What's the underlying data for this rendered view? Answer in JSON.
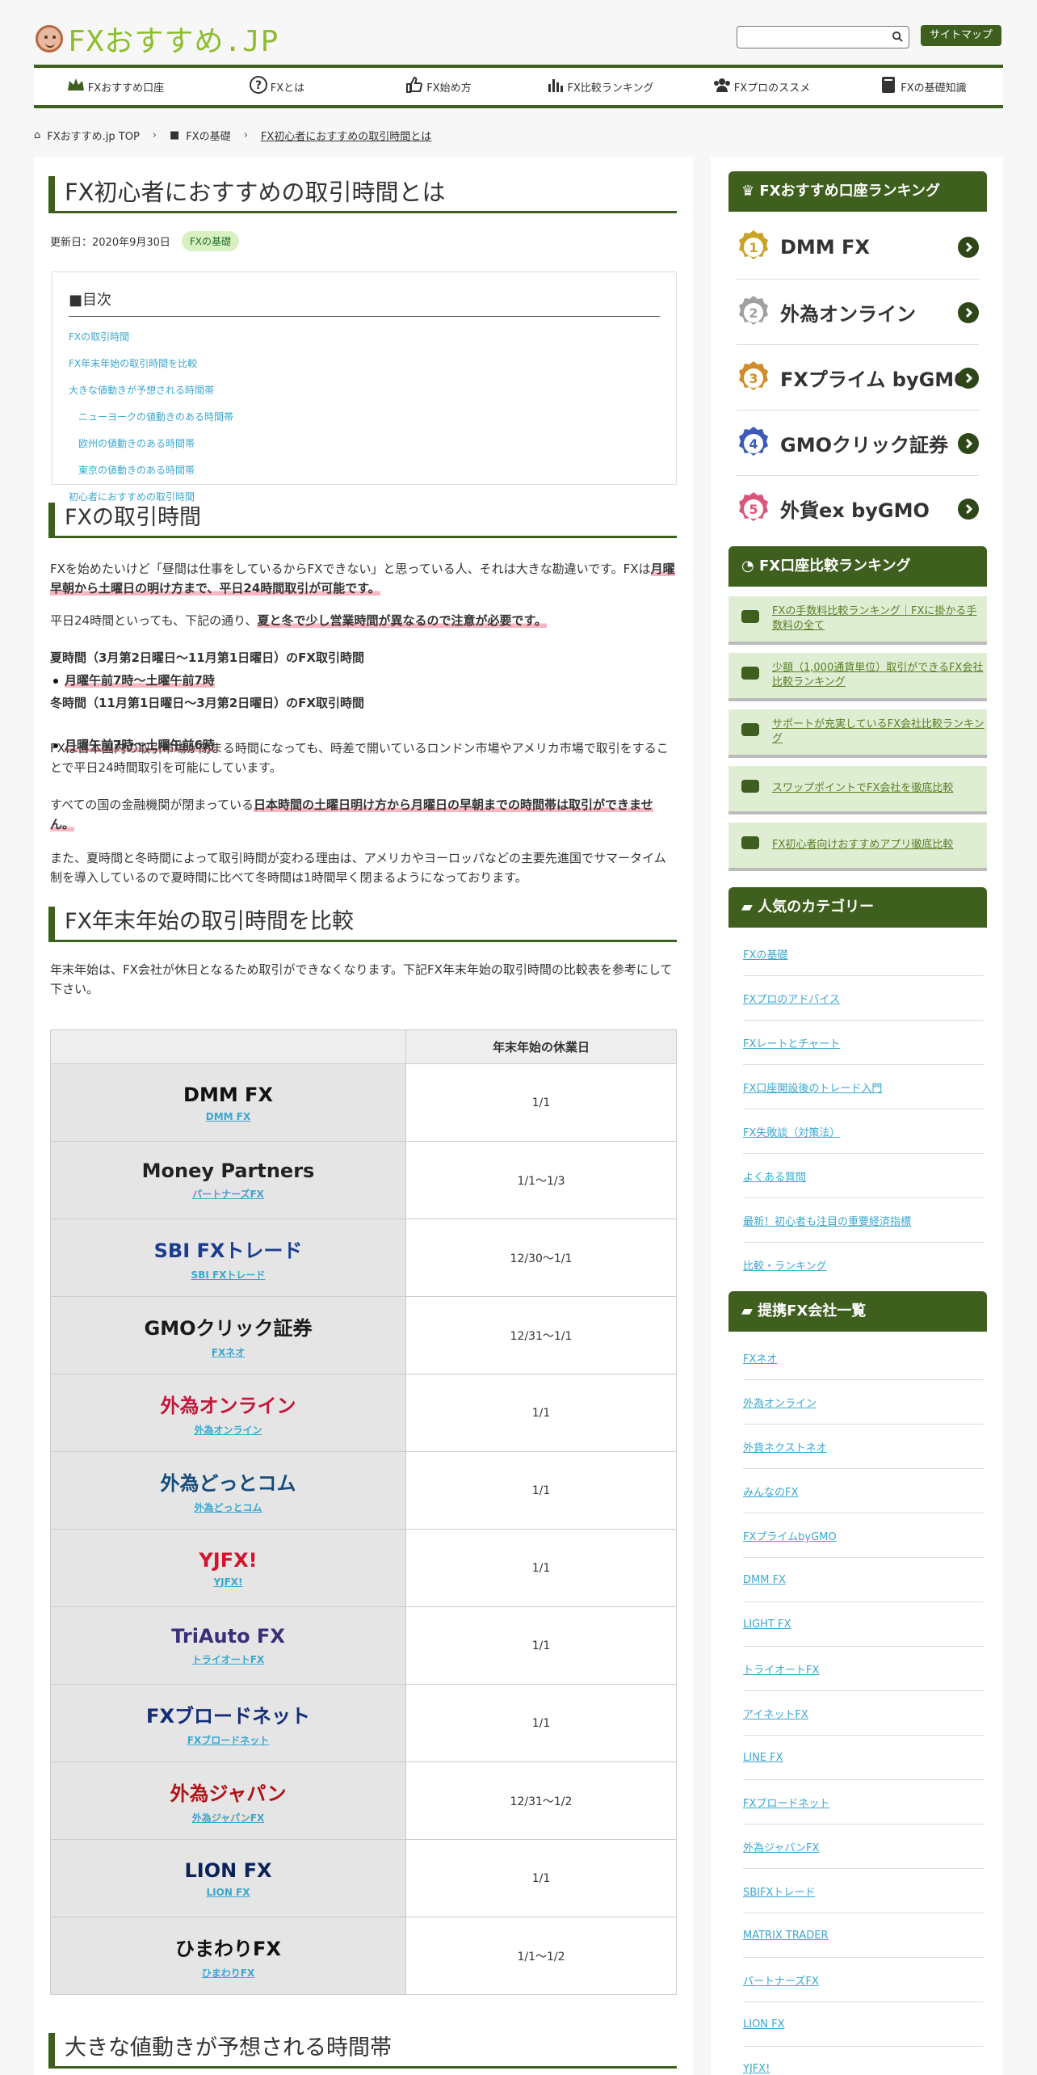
{
  "header": {
    "site_name": "FXおすすめ.JP",
    "sitemap_label": "サイトマップ"
  },
  "nav": [
    "FXおすすめ口座",
    "FXとは",
    "FX始め方",
    "FX比較ランキング",
    "FXプロのススメ",
    "FXの基礎知識"
  ],
  "breadcrumb": [
    "FXおすすめ.jp TOP",
    "FXの基礎",
    "FX初心者におすすめの取引時間とは"
  ],
  "article": {
    "title": "FX初心者におすすめの取引時間とは",
    "updated": "更新日：2020年9月30日",
    "tag": "FXの基礎",
    "toc_title": "■目次",
    "toc": [
      "FXの取引時間",
      "FX年末年始の取引時間を比較",
      "大きな値動きが予想される時間帯",
      "ニューヨークの値動きのある時間帯",
      "欧州の値動きのある時間帯",
      "東京の値動きのある時間帯",
      "初心者におすすめの取引時間"
    ],
    "h2_1": "FXの取引時間",
    "p1a": "FXを始めたいけど「昼間は仕事をしているからFXできない」と思っている人、それは大きな勘違いです。FXは",
    "p1b": "月曜早朝から土曜日の明け方まで、平日24時間取引が可能です。",
    "p2a": "平日24時間といっても、下記の通り、",
    "p2b": "夏と冬で少し営業時間が異なるので注意が必要です。",
    "summer_title": "夏時間（3月第2日曜日～11月第1日曜日）のFX取引時間",
    "summer_time": "月曜午前7時～土曜午前7時",
    "winter_title": "冬時間（11月第1日曜日～3月第2日曜日）のFX取引時間",
    "winter_time": "月曜午前7時～土曜午前6時",
    "p3": "FXは日本国内の取引市場が閉まる時間になっても、時差で開いているロンドン市場やアメリカ市場で取引をすることで平日24時間取引を可能にしています。",
    "p4a": "すべての国の金融機関が閉まっている",
    "p4b": "日本時間の土曜日明け方から月曜日の早朝までの時間帯は取引ができません。",
    "p5": "また、夏時間と冬時間によって取引時間が変わる理由は、アメリカやヨーロッパなどの主要先進国でサマータイム制を導入しているので夏時間に比べて冬時間は1時間早く閉まるようになっております。",
    "h2_2": "FX年末年始の取引時間を比較",
    "p6": "年末年始は、FX会社が休日となるため取引ができなくなります。下記FX年末年始の取引時間の比較表を参考にして下さい。",
    "table_header": "年末年始の休業日",
    "rows": [
      {
        "logo": "DMM FX",
        "name": "DMM FX",
        "holiday": "1/1",
        "color": "#111"
      },
      {
        "logo": "Money Partners",
        "name": "パートナーズFX",
        "holiday": "1/1～1/3",
        "color": "#222"
      },
      {
        "logo": "SBI FXトレード",
        "name": "SBI FXトレード",
        "holiday": "12/30～1/1",
        "color": "#1c3d8f"
      },
      {
        "logo": "GMOクリック証券",
        "name": "FXネオ",
        "holiday": "12/31～1/1",
        "color": "#1a1a1a"
      },
      {
        "logo": "外為オンライン",
        "name": "外為オンライン",
        "holiday": "1/1",
        "color": "#c4163a"
      },
      {
        "logo": "外為どっとコム",
        "name": "外為どっとコム",
        "holiday": "1/1",
        "color": "#164b7a"
      },
      {
        "logo": "YJFX!",
        "name": "YJFX!",
        "holiday": "1/1",
        "color": "#d4142b"
      },
      {
        "logo": "TriAuto FX",
        "name": "トライオートFX",
        "holiday": "1/1",
        "color": "#3b2f7a"
      },
      {
        "logo": "FXブロードネット",
        "name": "FXブロードネット",
        "holiday": "1/1",
        "color": "#142d78"
      },
      {
        "logo": "外為ジャパン",
        "name": "外為ジャパンFX",
        "holiday": "12/31～1/2",
        "color": "#b31217"
      },
      {
        "logo": "LION FX",
        "name": "LION FX",
        "holiday": "1/1",
        "color": "#0b2259"
      },
      {
        "logo": "ひまわりFX",
        "name": "ひまわりFX",
        "holiday": "1/1～1/2",
        "color": "#111"
      }
    ],
    "h2_3": "大きな値動きが予想される時間帯"
  },
  "sidebar": {
    "rank_title": "FXおすすめ口座ランキング",
    "ranks": [
      {
        "n": "1",
        "brand": "DMM FX",
        "medal": "#c9a227"
      },
      {
        "n": "2",
        "brand": "外為オンライン",
        "medal": "#a0a0a0"
      },
      {
        "n": "3",
        "brand": "FXプライム byGMO",
        "medal": "#d08c2a"
      },
      {
        "n": "4",
        "brand": "GMOクリック証券",
        "medal": "#3b5bb8"
      },
      {
        "n": "5",
        "brand": "外貨ex byGMO",
        "medal": "#d9577a"
      }
    ],
    "cmp_title": "FX口座比較ランキング",
    "cmp": [
      "FXの手数料比較ランキング｜FXに掛かる手数料の全て",
      "少額（1,000通貨単位）取引ができるFX会社比較ランキング",
      "サポートが充実しているFX会社比較ランキング",
      "スワップポイントでFX会社を徹底比較",
      "FX初心者向けおすすめアプリ徹底比較"
    ],
    "cat_title": "人気のカテゴリー",
    "cats": [
      "FXの基礎",
      "FXプロのアドバイス",
      "FXレートとチャート",
      "FX口座開設後のトレード入門",
      "FX失敗談（対策法）",
      "よくある質問",
      "最新！初心者も注目の重要経済指標",
      "比較・ランキング"
    ],
    "partner_title": "提携FX会社一覧",
    "partners": [
      "FXネオ",
      "外為オンライン",
      "外貨ネクストネオ",
      "みんなのFX",
      "FXプライムbyGMO",
      "DMM FX",
      "LIGHT FX",
      "トライオートFX",
      "アイネットFX",
      "LINE FX",
      "FXブロードネット",
      "外為ジャパンFX",
      "SBIFXトレード",
      "MATRIX TRADER",
      "パートナーズFX",
      "LION FX",
      "YJFX!"
    ]
  }
}
